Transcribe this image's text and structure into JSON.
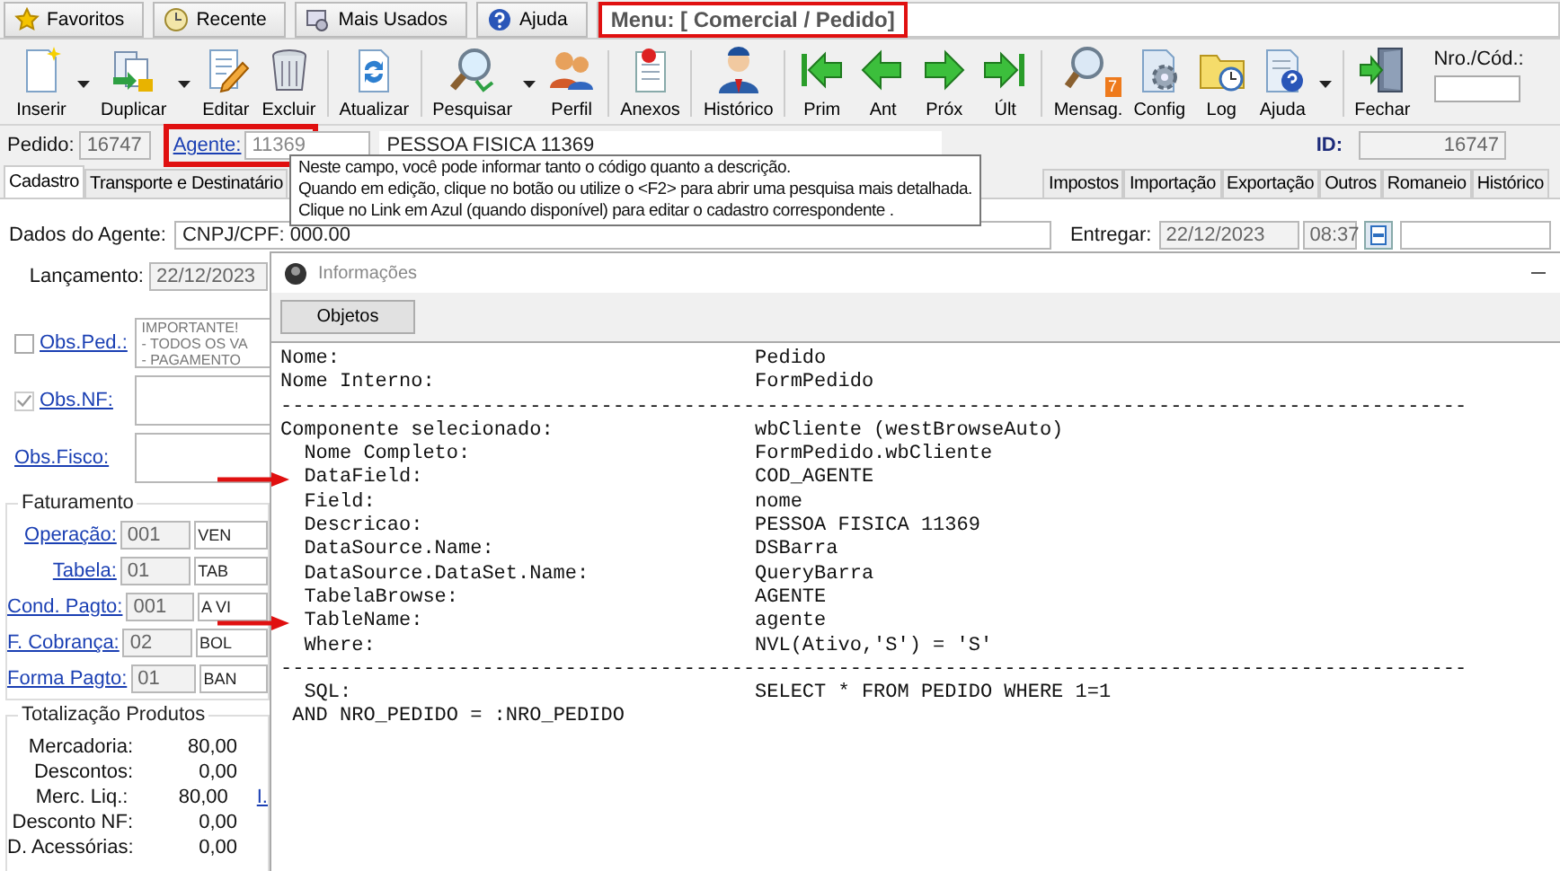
{
  "top_tabs": [
    {
      "label": "Favoritos",
      "kind": "star"
    },
    {
      "label": "Recente",
      "kind": "recent"
    },
    {
      "label": "Mais Usados",
      "kind": "used"
    },
    {
      "label": "Ajuda",
      "kind": "help"
    }
  ],
  "menu": {
    "text": "Menu: [ Comercial / Pedido]",
    "highlighted": true
  },
  "toolbar": [
    [
      {
        "label": "Inserir",
        "kind": "new",
        "dropdown": true
      },
      {
        "label": "Duplicar",
        "kind": "duplicate",
        "dropdown": true
      },
      {
        "label": "Editar",
        "kind": "edit",
        "dropdown": false
      },
      {
        "label": "Excluir",
        "kind": "delete",
        "dropdown": false
      }
    ],
    [
      {
        "label": "Atualizar",
        "kind": "refresh",
        "dropdown": false
      }
    ],
    [
      {
        "label": "Pesquisar",
        "kind": "search",
        "dropdown": true
      },
      {
        "label": "Perfil",
        "kind": "people",
        "dropdown": false
      }
    ],
    [
      {
        "label": "Anexos",
        "kind": "attach",
        "dropdown": false
      }
    ],
    [
      {
        "label": "Histórico",
        "kind": "person",
        "dropdown": false
      }
    ],
    [
      {
        "label": "Prim",
        "kind": "first",
        "dropdown": false
      },
      {
        "label": "Ant",
        "kind": "prev",
        "dropdown": false
      },
      {
        "label": "Próx",
        "kind": "next",
        "dropdown": false
      },
      {
        "label": "Últ",
        "kind": "last",
        "dropdown": false
      }
    ],
    [
      {
        "label": "Mensag.",
        "kind": "messages",
        "badge": "7",
        "dropdown": false
      },
      {
        "label": "Config",
        "kind": "config",
        "dropdown": false
      },
      {
        "label": "Log",
        "kind": "log",
        "dropdown": false
      },
      {
        "label": "Ajuda",
        "kind": "helpdoc",
        "dropdown": true
      }
    ],
    [
      {
        "label": "Fechar",
        "kind": "exit",
        "dropdown": false
      }
    ]
  ],
  "code_search": {
    "label": "Nro./Cód.:"
  },
  "header": {
    "pedido_label": "Pedido:",
    "pedido": "16747",
    "agente_label": "Agente:",
    "agente": "11369",
    "agente_highlighted": true,
    "agente_nome": "PESSOA FISICA 11369",
    "id_label": "ID:",
    "id": "16747"
  },
  "tabs": [
    {
      "label": "Cadastro",
      "selected": true
    },
    {
      "label": "Transporte e Destinatário",
      "selected": false
    },
    {
      "label": "Impostos",
      "selected": false
    },
    {
      "label": "Importação",
      "selected": false
    },
    {
      "label": "Exportação",
      "selected": false
    },
    {
      "label": "Outros",
      "selected": false
    },
    {
      "label": "Romaneio",
      "selected": false
    },
    {
      "label": "Histórico",
      "selected": false
    }
  ],
  "tooltip": {
    "lines": [
      "Neste campo, você pode informar tanto o código quanto a descrição.",
      "Quando em edição, clique no botão ou utilize o <F2> para abrir uma pesquisa mais detalhada.",
      "Clique no Link em Azul (quando disponível) para editar o cadastro correspondente ."
    ]
  },
  "form": {
    "agent_data": {
      "label": "Dados do Agente:",
      "value": "CNPJ/CPF: 000.00"
    },
    "entregar": {
      "label": "Entregar:",
      "date": "22/12/2023",
      "time": "08:37"
    },
    "lancamento": {
      "label": "Lançamento:",
      "value": "22/12/2023"
    },
    "obs": [
      {
        "label": "Obs.Ped.:",
        "checkbox": true,
        "checked": false,
        "lines": [
          "IMPORTANTE!",
          "- TODOS OS VA",
          "- PAGAMENTO"
        ]
      },
      {
        "label": "Obs.NF:",
        "checkbox": true,
        "checked": true
      },
      {
        "label": "Obs.Fisco:",
        "checkbox": false
      }
    ],
    "faturamento": {
      "title": "Faturamento",
      "rows": [
        {
          "label": "Operação:",
          "code": "001",
          "desc": "VEN"
        },
        {
          "label": "Tabela:",
          "code": "01",
          "desc": "TAB"
        },
        {
          "label": "Cond. Pagto:",
          "code": "001",
          "desc": "A VI"
        },
        {
          "label": "F. Cobrança:",
          "code": "02",
          "desc": "BOL"
        },
        {
          "label": "Forma Pagto:",
          "code": "01",
          "desc": "BAN"
        }
      ]
    },
    "totals": {
      "title": "Totalização Produtos",
      "rows": [
        {
          "label": "Mercadoria:",
          "value": "80,00"
        },
        {
          "label": "Descontos:",
          "value": "0,00"
        },
        {
          "label": "Merc. Liq.:",
          "value": "80,00",
          "link": "I."
        },
        {
          "label": "Desconto NF:",
          "value": "0,00"
        },
        {
          "label": "D. Acessórias:",
          "value": "0,00"
        }
      ]
    }
  },
  "dialog": {
    "title": "Informações",
    "button": "Objetos",
    "lines": [
      {
        "key": "Nome:",
        "value": "Pedido"
      },
      {
        "key": "Nome Interno:",
        "value": "FormPedido"
      },
      {
        "kind": "rule",
        "text": "----------------------------------------------------------------------------------------------------"
      },
      {
        "key": "Componente selecionado:",
        "value": "wbCliente (westBrowseAuto)"
      },
      {
        "key": "Nome Completo:",
        "value": "FormPedido.wbCliente",
        "indented": true
      },
      {
        "key": "DataField:",
        "value": "COD_AGENTE",
        "indented": true,
        "marked": true
      },
      {
        "key": "Field:",
        "value": "nome",
        "indented": true
      },
      {
        "key": "Descricao:",
        "value": "PESSOA FISICA 11369",
        "indented": true
      },
      {
        "key": "DataSource.Name:",
        "value": "DSBarra",
        "indented": true
      },
      {
        "key": "DataSource.DataSet.Name:",
        "value": "QueryBarra",
        "indented": true
      },
      {
        "key": "TabelaBrowse:",
        "value": "AGENTE",
        "indented": true
      },
      {
        "key": "TableName:",
        "value": "agente",
        "indented": true,
        "marked": true
      },
      {
        "key": "Where:",
        "value": "NVL(Ativo,'S') = 'S'",
        "indented": true
      },
      {
        "kind": "rule",
        "text": "----------------------------------------------------------------------------------------------------"
      },
      {
        "key": "SQL:",
        "value": "SELECT * FROM PEDIDO WHERE 1=1",
        "indented": true
      },
      {
        "kind": "continuation",
        "text": "AND NRO_PEDIDO = :NRO_PEDIDO"
      }
    ]
  }
}
